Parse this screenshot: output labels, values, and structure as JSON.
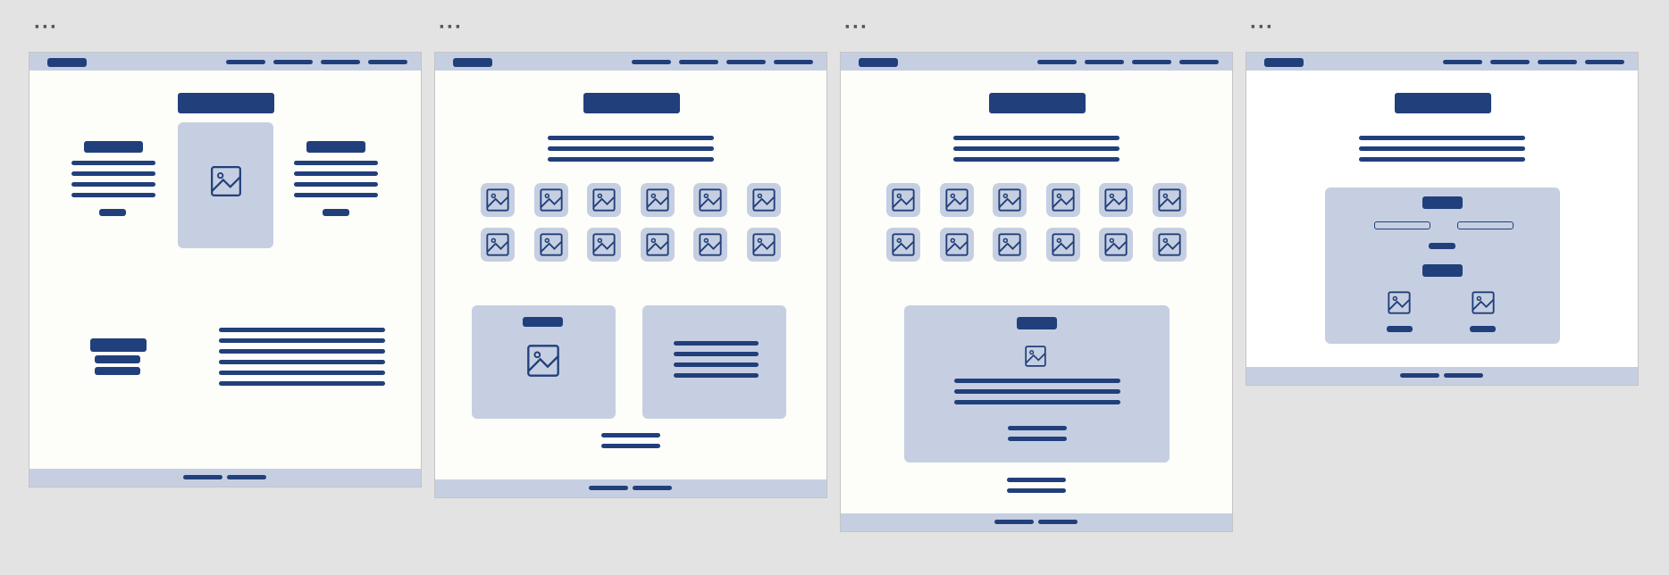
{
  "canvas": {
    "background": "#e3e3e3",
    "frame_menu_icon": "ellipsis-icon",
    "frame_count": 4
  },
  "colors": {
    "primary": "#213f7b",
    "secondary": "#c6cfe1",
    "frame_background": "#fdfdf9",
    "frame_background_alt": "#ffffff"
  },
  "frames": [
    {
      "name": "wireframe-1",
      "nav_items": 4,
      "sections": [
        "hero-title",
        "feature-left",
        "center-image",
        "feature-right",
        "text-block-left",
        "paragraph-right"
      ],
      "footer_links": 2
    },
    {
      "name": "wireframe-2",
      "nav_items": 4,
      "sections": [
        "hero-title",
        "intro-text",
        "image-grid-6x2",
        "image-card",
        "text-card",
        "cta-lines"
      ],
      "footer_links": 2
    },
    {
      "name": "wireframe-3",
      "nav_items": 4,
      "sections": [
        "hero-title",
        "intro-text",
        "image-grid-6x2",
        "feature-card",
        "cta-lines"
      ],
      "footer_links": 2
    },
    {
      "name": "wireframe-4",
      "nav_items": 4,
      "sections": [
        "hero-title",
        "intro-text",
        "form-card"
      ],
      "footer_links": 2
    }
  ]
}
